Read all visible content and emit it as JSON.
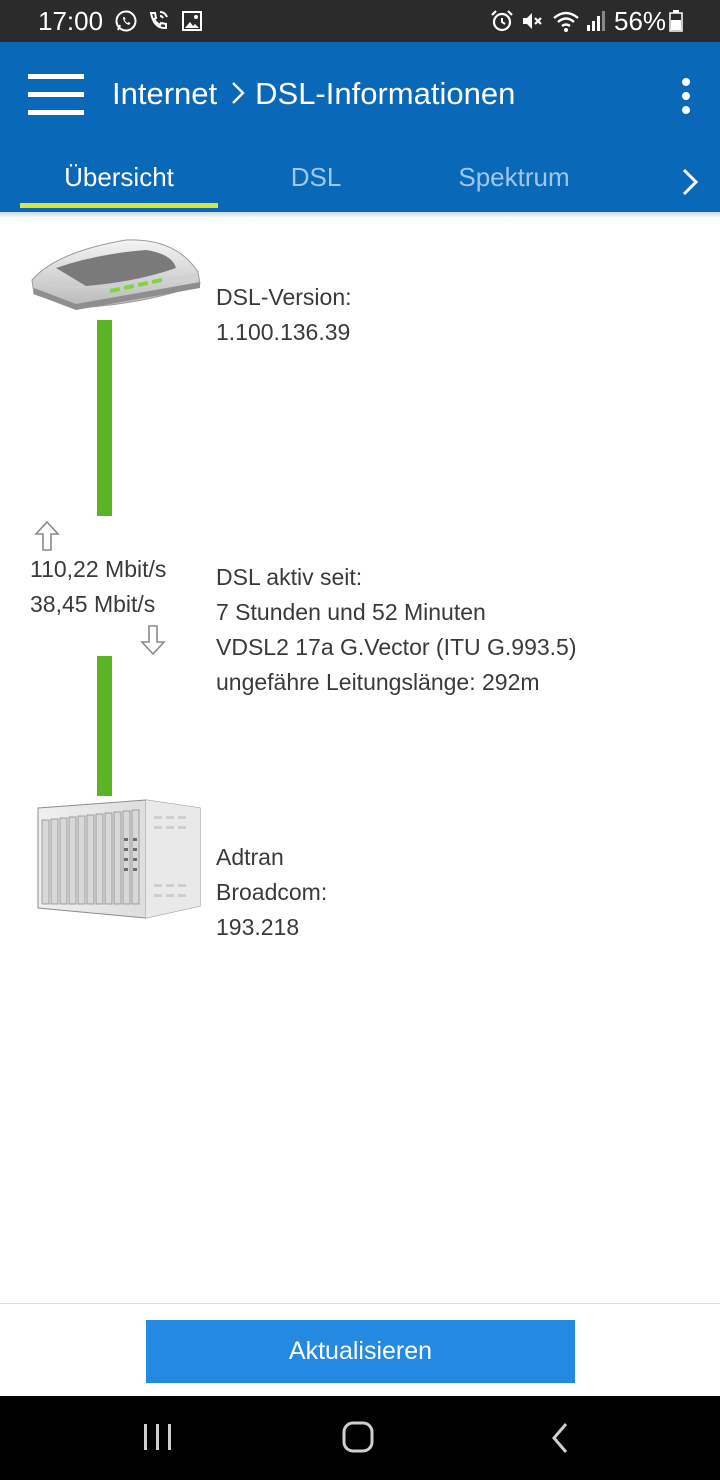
{
  "status_bar": {
    "time": "17:00",
    "left_icons": [
      "whatsapp-icon",
      "wifi-call-icon",
      "image-icon"
    ],
    "right_icons": [
      "alarm-icon",
      "mute-icon",
      "wifi-icon",
      "signal-icon",
      "battery-icon"
    ],
    "battery": "56%"
  },
  "app_bar": {
    "title_parent": "Internet",
    "title_separator": ">",
    "title_current": "DSL-Informationen",
    "color": "#0a68b8"
  },
  "tabs": [
    {
      "label": "Übersicht",
      "active": true
    },
    {
      "label": "DSL",
      "active": false
    },
    {
      "label": "Spektrum",
      "active": false
    }
  ],
  "router": {
    "version_label": "DSL-Version:",
    "version_value": "1.100.136.39"
  },
  "line": {
    "upstream": "110,22 Mbit/s",
    "downstream": "38,45 Mbit/s",
    "active_label": "DSL aktiv seit:",
    "active_duration": "7 Stunden und 52 Minuten",
    "standard": "VDSL2 17a G.Vector (ITU G.993.5)",
    "length": "ungefähre Leitungslänge: 292m",
    "line_color": "#5ab424"
  },
  "dslam": {
    "vendor": "Adtran",
    "chipset_label": "Broadcom:",
    "chipset_version": "193.218"
  },
  "actions": {
    "refresh_label": "Aktualisieren",
    "button_color": "#2489e0"
  },
  "nav_bar": {
    "icons": [
      "recent-apps-icon",
      "home-icon",
      "back-icon"
    ]
  }
}
